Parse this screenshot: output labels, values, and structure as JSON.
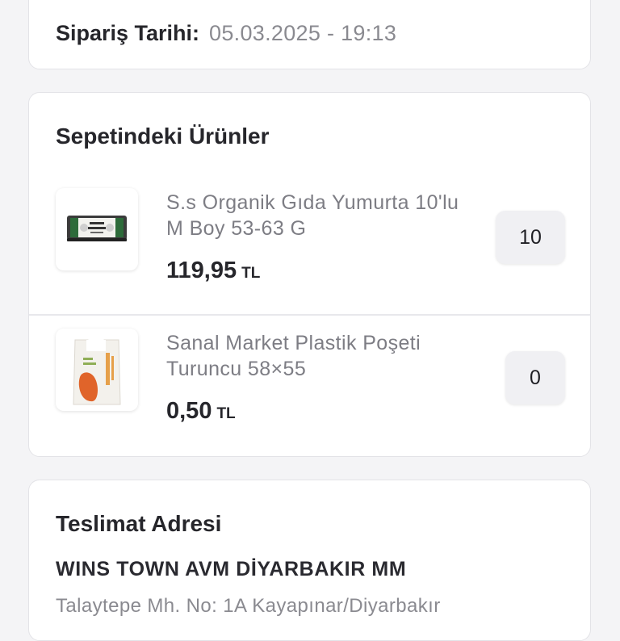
{
  "order": {
    "date_label": "Sipariş Tarihi:",
    "date_value": "05.03.2025 - 19:13"
  },
  "basket": {
    "title": "Sepetindeki Ürünler",
    "currency": "TL",
    "items": [
      {
        "name": "S.s Organik Gıda Yumurta 10'lu M Boy 53-63 G",
        "price": "119,95",
        "quantity": "10",
        "image_icon": "egg-carton-icon",
        "image_text": "ORGANİK YUMURTA"
      },
      {
        "name": "Sanal Market Plastik Poşeti Turuncu 58×55",
        "price": "0,50",
        "quantity": "0",
        "image_icon": "plastic-bag-icon"
      }
    ]
  },
  "address": {
    "title": "Teslimat Adresi",
    "name": "WINS TOWN AVM DİYARBAKIR MM",
    "line": "Talaytepe Mh. No: 1A Kayapınar/Diyarbakır"
  },
  "colors": {
    "background": "#f4f4f6",
    "card": "#ffffff",
    "muted_text": "#8a8a90",
    "bag_orange": "#e0642a"
  }
}
